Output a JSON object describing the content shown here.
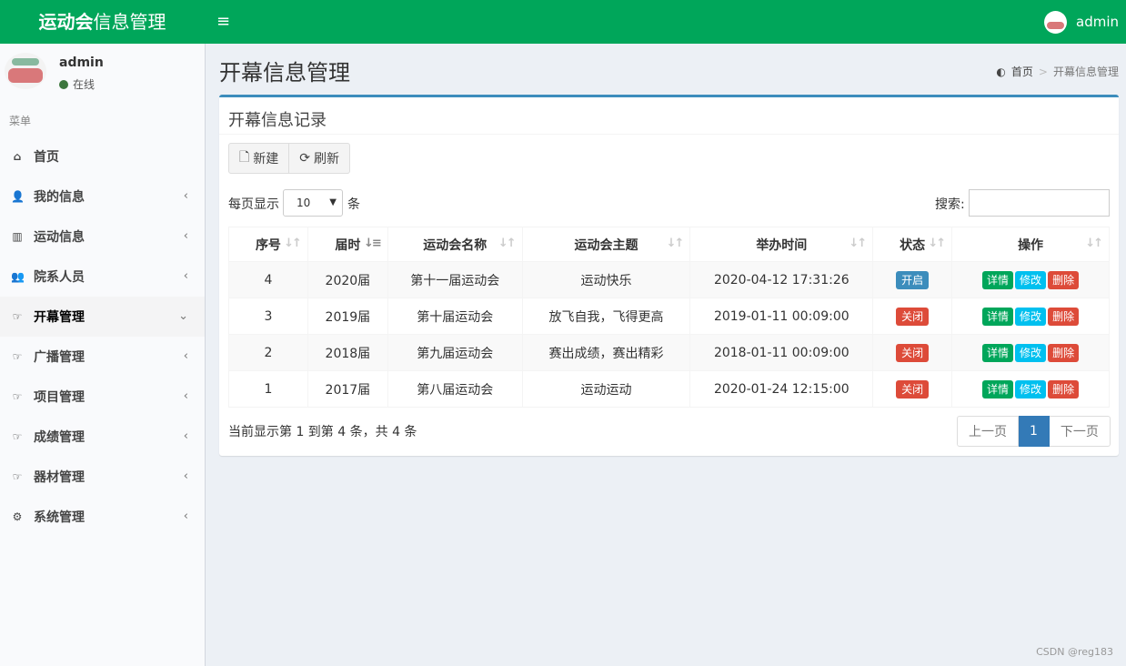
{
  "header": {
    "brand_bold": "运动会",
    "brand_rest": "信息管理",
    "toggle_icon": "≡",
    "user": "admin",
    "accent": "#00a65a"
  },
  "sidebar": {
    "user_name": "admin",
    "status": "在线",
    "menu_header": "菜单",
    "items": [
      {
        "label": "首页",
        "icon": "home-icon",
        "glyph": "⌂"
      },
      {
        "label": "我的信息",
        "icon": "user-icon",
        "glyph": "👤"
      },
      {
        "label": "运动信息",
        "icon": "bar-chart-icon",
        "glyph": "▥"
      },
      {
        "label": "院系人员",
        "icon": "users-icon",
        "glyph": "👥"
      },
      {
        "label": "开幕管理",
        "icon": "hand-pointer-icon",
        "glyph": "☞"
      },
      {
        "label": "广播管理",
        "icon": "hand-pointer-icon",
        "glyph": "☞"
      },
      {
        "label": "项目管理",
        "icon": "hand-pointer-icon",
        "glyph": "☞"
      },
      {
        "label": "成绩管理",
        "icon": "hand-pointer-icon",
        "glyph": "☞"
      },
      {
        "label": "器材管理",
        "icon": "hand-pointer-icon",
        "glyph": "☞"
      },
      {
        "label": "系统管理",
        "icon": "gear-icon",
        "glyph": "⚙"
      }
    ]
  },
  "page": {
    "title": "开幕信息管理",
    "breadcrumb_home": "首页",
    "breadcrumb_current": "开幕信息管理"
  },
  "box": {
    "title": "开幕信息记录",
    "new_label": "新建",
    "refresh_label": "刷新",
    "length_prefix": "每页显示",
    "length_value": "10",
    "length_suffix": "条",
    "search_label": "搜索:"
  },
  "table": {
    "headers": [
      "序号",
      "届时",
      "运动会名称",
      "运动会主题",
      "举办时间",
      "状态",
      "操作"
    ],
    "rows": [
      {
        "id": "4",
        "session": "2020届",
        "name": "第十一届运动会",
        "theme": "运动快乐",
        "time": "2020-04-12 17:31:26",
        "status": "开启",
        "status_color": "#3c8dbc"
      },
      {
        "id": "3",
        "session": "2019届",
        "name": "第十届运动会",
        "theme": "放飞自我，飞得更高",
        "time": "2019-01-11 00:09:00",
        "status": "关闭",
        "status_color": "#dd4b39"
      },
      {
        "id": "2",
        "session": "2018届",
        "name": "第九届运动会",
        "theme": "赛出成绩，赛出精彩",
        "time": "2018-01-11 00:09:00",
        "status": "关闭",
        "status_color": "#dd4b39"
      },
      {
        "id": "1",
        "session": "2017届",
        "name": "第八届运动会",
        "theme": "运动运动",
        "time": "2020-01-24 12:15:00",
        "status": "关闭",
        "status_color": "#dd4b39"
      }
    ],
    "op_detail": "详情",
    "op_edit": "修改",
    "op_delete": "删除"
  },
  "footer": {
    "info": "当前显示第 1 到第 4 条，共 4 条",
    "prev": "上一页",
    "page": "1",
    "next": "下一页"
  },
  "watermark": "CSDN @reg183"
}
